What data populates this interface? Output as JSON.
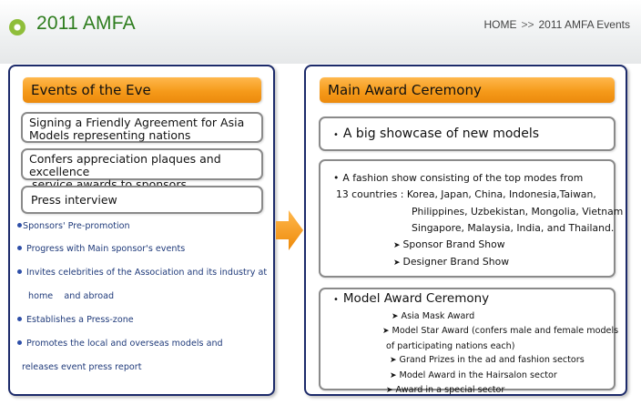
{
  "header": {
    "title": "2011 AMFA",
    "breadcrumb": {
      "home": "HOME",
      "separator": ">>",
      "current": "2011 AMFA Events"
    }
  },
  "left_panel": {
    "heading": "Events of the Eve",
    "boxes": [
      {
        "lines": [
          "Signing a Friendly Agreement for Asia",
          "Models representing nations"
        ]
      },
      {
        "lines": [
          "Confers appreciation plaques and excellence",
          "service awards to sponsors"
        ]
      },
      {
        "lines": [
          "Press interview"
        ]
      }
    ],
    "bullets": [
      {
        "lines": [
          "Sponsors'  Pre-promotion"
        ]
      },
      {
        "lines": [
          "Progress with Main sponsor's events"
        ]
      },
      {
        "lines": [
          "Invites celebrities of the Association and its  industry at",
          "home    and abroad"
        ]
      },
      {
        "lines": [
          "Establishes a Press-zone"
        ]
      },
      {
        "lines": [
          "Promotes the local and overseas models and",
          "releases event press report"
        ]
      }
    ]
  },
  "right_panel": {
    "heading": "Main Award Ceremony",
    "showcase": "A big showcase of new models",
    "fashion_show": {
      "lines": [
        "A fashion show consisting of  the top modes from",
        "13 countries : Korea, Japan, China, Indonesia,Taiwan,",
        "Philippines, Uzbekistan, Mongolia, Vietnam",
        "Singapore, Malaysia, India, and Thailand."
      ],
      "shows": [
        "Sponsor Brand Show",
        "Designer Brand Show"
      ]
    },
    "model_award": {
      "title": "Model Award Ceremony",
      "items": [
        "Asia Mask Award",
        "Model Star Award (confers male and female models",
        "of participating nations each)",
        "Grand Prizes in the ad and fashion sectors",
        "Model Award in the Hairsalon  sector",
        "Award in a special sector"
      ]
    }
  },
  "colors": {
    "accent_orange": "#f59a1a",
    "panel_border": "#1c2a6a",
    "title_green": "#2e7d1e",
    "bullet_blue": "#1f3a7a"
  }
}
